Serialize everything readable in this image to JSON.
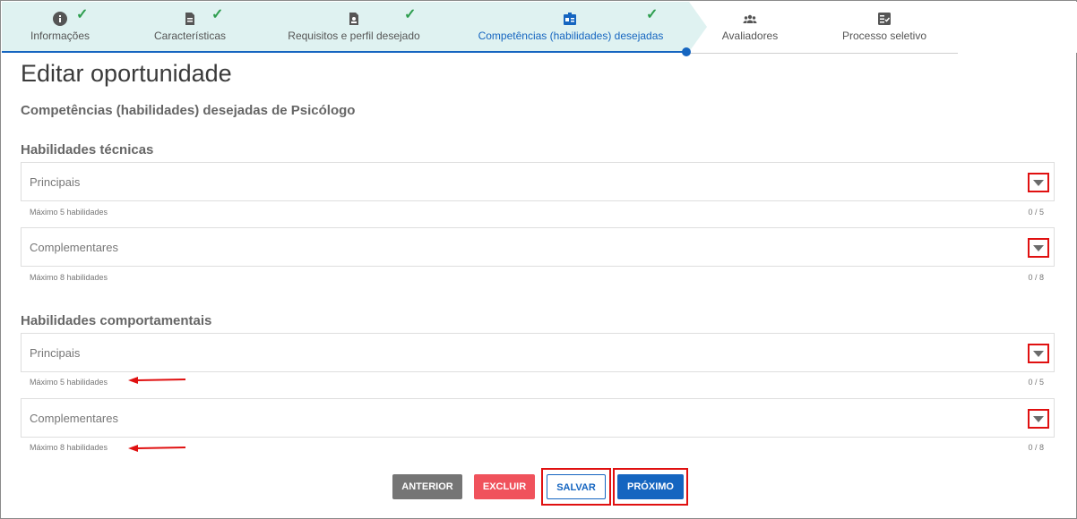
{
  "stepper": {
    "steps": [
      {
        "label": "Informações",
        "icon": "info-icon",
        "done": true
      },
      {
        "label": "Características",
        "icon": "document-icon",
        "done": true
      },
      {
        "label": "Requisitos e perfil desejado",
        "icon": "profile-document-icon",
        "done": true
      },
      {
        "label": "Competências (habilidades) desejadas",
        "icon": "badge-icon",
        "done": true,
        "active": true
      },
      {
        "label": "Avaliadores",
        "icon": "group-icon",
        "done": false
      },
      {
        "label": "Processo seletivo",
        "icon": "checklist-icon",
        "done": false
      }
    ],
    "check_color": "#2e9e4f",
    "active_color": "#1565c0"
  },
  "page": {
    "title": "Editar oportunidade",
    "subtitle": "Competências (habilidades) desejadas de Psicólogo"
  },
  "technical": {
    "title": "Habilidades técnicas",
    "main": {
      "placeholder": "Principais",
      "hint": "Máximo 5 habilidades",
      "counter": "0 / 5"
    },
    "complementary": {
      "placeholder": "Complementares",
      "hint": "Máximo 8 habilidades",
      "counter": "0 / 8"
    }
  },
  "behavioral": {
    "title": "Habilidades comportamentais",
    "main": {
      "placeholder": "Principais",
      "hint": "Máximo 5 habilidades",
      "counter": "0 / 5"
    },
    "complementary": {
      "placeholder": "Complementares",
      "hint": "Máximo 8 habilidades",
      "counter": "0 / 8"
    }
  },
  "actions": {
    "previous": "ANTERIOR",
    "delete": "EXCLUIR",
    "save": "SALVAR",
    "next": "PRÓXIMO"
  },
  "colors": {
    "primary": "#1565c0",
    "danger": "#f0525c",
    "annotation": "#e01010"
  }
}
